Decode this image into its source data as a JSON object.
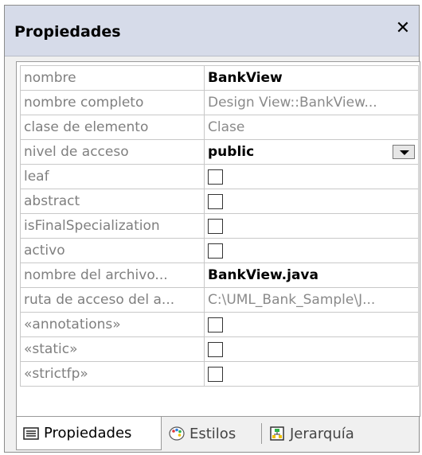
{
  "panel": {
    "title": "Propiedades"
  },
  "rows": [
    {
      "name": "nombre",
      "value": "BankView",
      "kind": "text-bold"
    },
    {
      "name": "nombre completo",
      "value": "Design View::BankView...",
      "kind": "text-gray"
    },
    {
      "name": "clase de elemento",
      "value": "Clase",
      "kind": "text-gray"
    },
    {
      "name": "nivel de acceso",
      "value": "public",
      "kind": "dropdown"
    },
    {
      "name": "leaf",
      "value": "",
      "kind": "checkbox",
      "checked": false
    },
    {
      "name": "abstract",
      "value": "",
      "kind": "checkbox",
      "checked": false
    },
    {
      "name": "isFinalSpecialization",
      "value": "",
      "kind": "checkbox",
      "checked": false
    },
    {
      "name": "activo",
      "value": "",
      "kind": "checkbox",
      "checked": false
    },
    {
      "name": "nombre del archivo...",
      "value": "BankView.java",
      "kind": "text-bold"
    },
    {
      "name": "ruta de acceso del a...",
      "value": "C:\\UML_Bank_Sample\\J...",
      "kind": "text-gray"
    },
    {
      "name": "«annotations»",
      "value": "",
      "kind": "checkbox",
      "checked": false
    },
    {
      "name": "«static»",
      "value": "",
      "kind": "checkbox",
      "checked": false
    },
    {
      "name": "«strictfp»",
      "value": "",
      "kind": "checkbox",
      "checked": false
    }
  ],
  "tabs": [
    {
      "label": "Propiedades",
      "icon": "properties-list-icon",
      "active": true
    },
    {
      "label": "Estilos",
      "icon": "palette-icon",
      "active": false
    },
    {
      "label": "Jerarquía",
      "icon": "hierarchy-icon",
      "active": false
    }
  ],
  "colors": {
    "titlebar": "#d6dbe9",
    "panel_bg": "#f0f0f0",
    "label_text": "#7f7f7f"
  }
}
